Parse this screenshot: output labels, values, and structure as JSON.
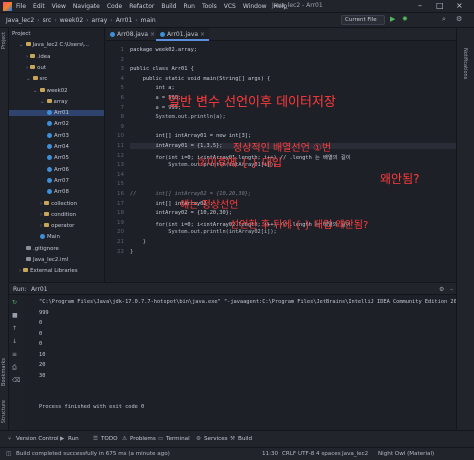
{
  "window": {
    "title": "Java_lec2 - Arr01",
    "menu": [
      "File",
      "Edit",
      "View",
      "Navigate",
      "Code",
      "Refactor",
      "Build",
      "Run",
      "Tools",
      "VCS",
      "Window",
      "Help"
    ]
  },
  "breadcrumb": [
    "Java_lec2",
    "src",
    "week02",
    "array",
    "Arr01",
    "main"
  ],
  "run_config": "Current File",
  "left_strip": [
    "Project",
    "Bookmarks",
    "Structure"
  ],
  "right_strip": [
    "Notifications"
  ],
  "project_tree": [
    {
      "label": "Project",
      "indent": 0,
      "type": "header"
    },
    {
      "label": "Java_lec2  C:\\Users\\...",
      "indent": 1,
      "type": "folder",
      "arrow": "v"
    },
    {
      "label": ".idea",
      "indent": 2,
      "type": "folder",
      "arrow": ">"
    },
    {
      "label": "out",
      "indent": 2,
      "type": "folder",
      "arrow": ">"
    },
    {
      "label": "src",
      "indent": 2,
      "type": "folder",
      "arrow": "v"
    },
    {
      "label": "week02",
      "indent": 3,
      "type": "folder",
      "arrow": "v"
    },
    {
      "label": "array",
      "indent": 4,
      "type": "folder",
      "arrow": "v"
    },
    {
      "label": "Arr01",
      "indent": 5,
      "type": "java",
      "selected": true
    },
    {
      "label": "Arr02",
      "indent": 5,
      "type": "java"
    },
    {
      "label": "Arr03",
      "indent": 5,
      "type": "java"
    },
    {
      "label": "Arr04",
      "indent": 5,
      "type": "java"
    },
    {
      "label": "Arr05",
      "indent": 5,
      "type": "java"
    },
    {
      "label": "Arr06",
      "indent": 5,
      "type": "java"
    },
    {
      "label": "Arr07",
      "indent": 5,
      "type": "java"
    },
    {
      "label": "Arr08",
      "indent": 5,
      "type": "java"
    },
    {
      "label": "collection",
      "indent": 4,
      "type": "folder",
      "arrow": ">"
    },
    {
      "label": "condition",
      "indent": 4,
      "type": "folder",
      "arrow": ">"
    },
    {
      "label": "operator",
      "indent": 4,
      "type": "folder",
      "arrow": ">"
    },
    {
      "label": "Main",
      "indent": 4,
      "type": "java"
    },
    {
      "label": ".gitignore",
      "indent": 2,
      "type": "file"
    },
    {
      "label": "Java_lec2.iml",
      "indent": 2,
      "type": "file"
    },
    {
      "label": "External Libraries",
      "indent": 1,
      "type": "folder",
      "arrow": ">"
    }
  ],
  "editor_tabs": [
    {
      "label": "Arr08.java",
      "active": false
    },
    {
      "label": "Arr01.java",
      "active": true
    }
  ],
  "code_lines": [
    {
      "n": "1",
      "t": "package week02.array;"
    },
    {
      "n": "2",
      "t": ""
    },
    {
      "n": "3",
      "t": "public class Arr01 {"
    },
    {
      "n": "4",
      "t": "    public static void main(String[] args) {"
    },
    {
      "n": "5",
      "t": "        int a;"
    },
    {
      "n": "6",
      "t": "        a = 500;"
    },
    {
      "n": "7",
      "t": "        a = 999;"
    },
    {
      "n": "8",
      "t": "        System.out.println(a);"
    },
    {
      "n": "9",
      "t": ""
    },
    {
      "n": "10",
      "t": "        int[] intArray01 = new int[3];"
    },
    {
      "n": "11",
      "t": "        intArray01 = {1,3,5};"
    },
    {
      "n": "12",
      "t": "        for(int i=0; i<intArray01.length; i++) // .length 는 배열의 길이"
    },
    {
      "n": "13",
      "t": "            System.out.println(intArray01[i]);"
    },
    {
      "n": "14",
      "t": ""
    },
    {
      "n": "15",
      "t": ""
    },
    {
      "n": "16",
      "t": "//      int[] intArray02 = {10,20,30};"
    },
    {
      "n": "17",
      "t": "        int[] intArray02 ;"
    },
    {
      "n": "18",
      "t": "        intArray02 = {10,20,30};"
    },
    {
      "n": "19",
      "t": "        for(int i=0; i<intArray02.length; i++) // .length 는 배열의 길이"
    },
    {
      "n": "20",
      "t": "            System.out.println(intArray02[i]);"
    },
    {
      "n": "21",
      "t": "    }"
    },
    {
      "n": "22",
      "t": "}"
    }
  ],
  "annotations": {
    "a1": "일반 변수 선언이후 데이터저장",
    "a2": "정상적인 배열선언 ①번",
    "a3": "②이후에 { } 대입",
    "a4": "왜안됨?",
    "a5": "얘는 정상선언",
    "a6": "선언한 후 뒤에 { } 대입 왜안됨?"
  },
  "run_panel": {
    "label": "Run:",
    "tab": "Arr01",
    "output": [
      "\"C:\\Program Files\\Java\\jdk-17.0.7.7-hotspot\\bin\\java.exe\" \"-javaagent:C:\\Program Files\\JetBrains\\IntelliJ IDEA Community Edition 2022",
      "999",
      "0",
      "0",
      "0",
      "10",
      "20",
      "30",
      "",
      "",
      "Process finished with exit code 0"
    ]
  },
  "tool_windows": [
    "Version Control",
    "Run",
    "TODO",
    "Problems",
    "Terminal",
    "Services",
    "Build"
  ],
  "status_bar": {
    "message": "Build completed successfully in 675 ms (a minute ago)",
    "position": "11:30",
    "line_sep": "CRLF",
    "encoding": "UTF-8",
    "indent": "4 spaces",
    "project": "Java_lec2",
    "theme": "Night Owl (Material)"
  }
}
